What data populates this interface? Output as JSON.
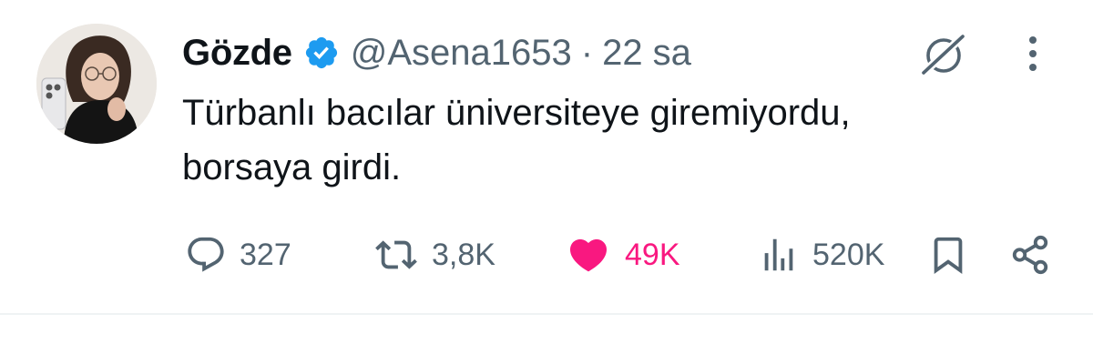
{
  "author": {
    "display_name": "Gözde",
    "handle": "@Asena1653",
    "separator": "·",
    "time": "22 sa",
    "verified": true
  },
  "tweet": {
    "text_line1": "Türbanlı bacılar üniversiteye giremiyordu,",
    "text_line2": "borsaya girdi."
  },
  "actions": {
    "reply_count": "327",
    "retweet_count": "3,8K",
    "like_count": "49K",
    "view_count": "520K",
    "liked": true
  },
  "icons": {
    "reply": "reply-icon",
    "retweet": "retweet-icon",
    "like": "heart-icon",
    "views": "views-icon",
    "bookmark": "bookmark-icon",
    "share": "share-icon",
    "grok": "grok-icon",
    "more": "more-icon",
    "verified": "verified-badge-icon"
  },
  "colors": {
    "text_primary": "#0f1419",
    "text_secondary": "#536471",
    "verified_blue": "#1d9bf0",
    "like_pink": "#f91880"
  }
}
